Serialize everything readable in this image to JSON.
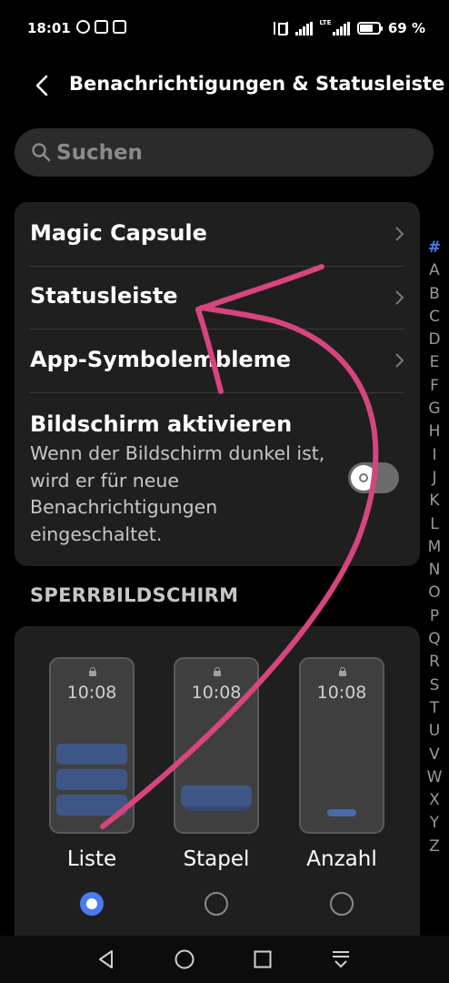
{
  "status_bar": {
    "time": "18:01",
    "network_label": "LTE",
    "battery_percent": "69 %",
    "battery_level": 0.69,
    "left_icons": [
      "alarm-icon",
      "car-icon",
      "app-icon"
    ]
  },
  "header": {
    "title": "Benachrichtigungen & Statusleiste"
  },
  "search": {
    "placeholder": "Suchen"
  },
  "settings": {
    "magic_capsule": "Magic Capsule",
    "statusleiste": "Statusleiste",
    "app_badges": "App-Symbolembleme",
    "wake_screen": {
      "title": "Bildschirm aktivieren",
      "description": "Wenn der Bildschirm dunkel ist, wird er für neue Benachrichtigungen eingeschaltet.",
      "enabled": false
    }
  },
  "lockscreen": {
    "section_title": "SPERRBILDSCHIRM",
    "preview_time": "10:08",
    "options": [
      {
        "label": "Liste",
        "selected": true
      },
      {
        "label": "Stapel",
        "selected": false
      },
      {
        "label": "Anzahl",
        "selected": false
      }
    ]
  },
  "alphabet_index": [
    "#",
    "A",
    "B",
    "C",
    "D",
    "E",
    "F",
    "G",
    "H",
    "I",
    "J",
    "K",
    "L",
    "M",
    "N",
    "O",
    "P",
    "Q",
    "R",
    "S",
    "T",
    "U",
    "V",
    "W",
    "X",
    "Y",
    "Z"
  ],
  "colors": {
    "background": "#000000",
    "card": "#1f1f1f",
    "accent": "#4b7bef",
    "annotation": "#d6457d"
  }
}
